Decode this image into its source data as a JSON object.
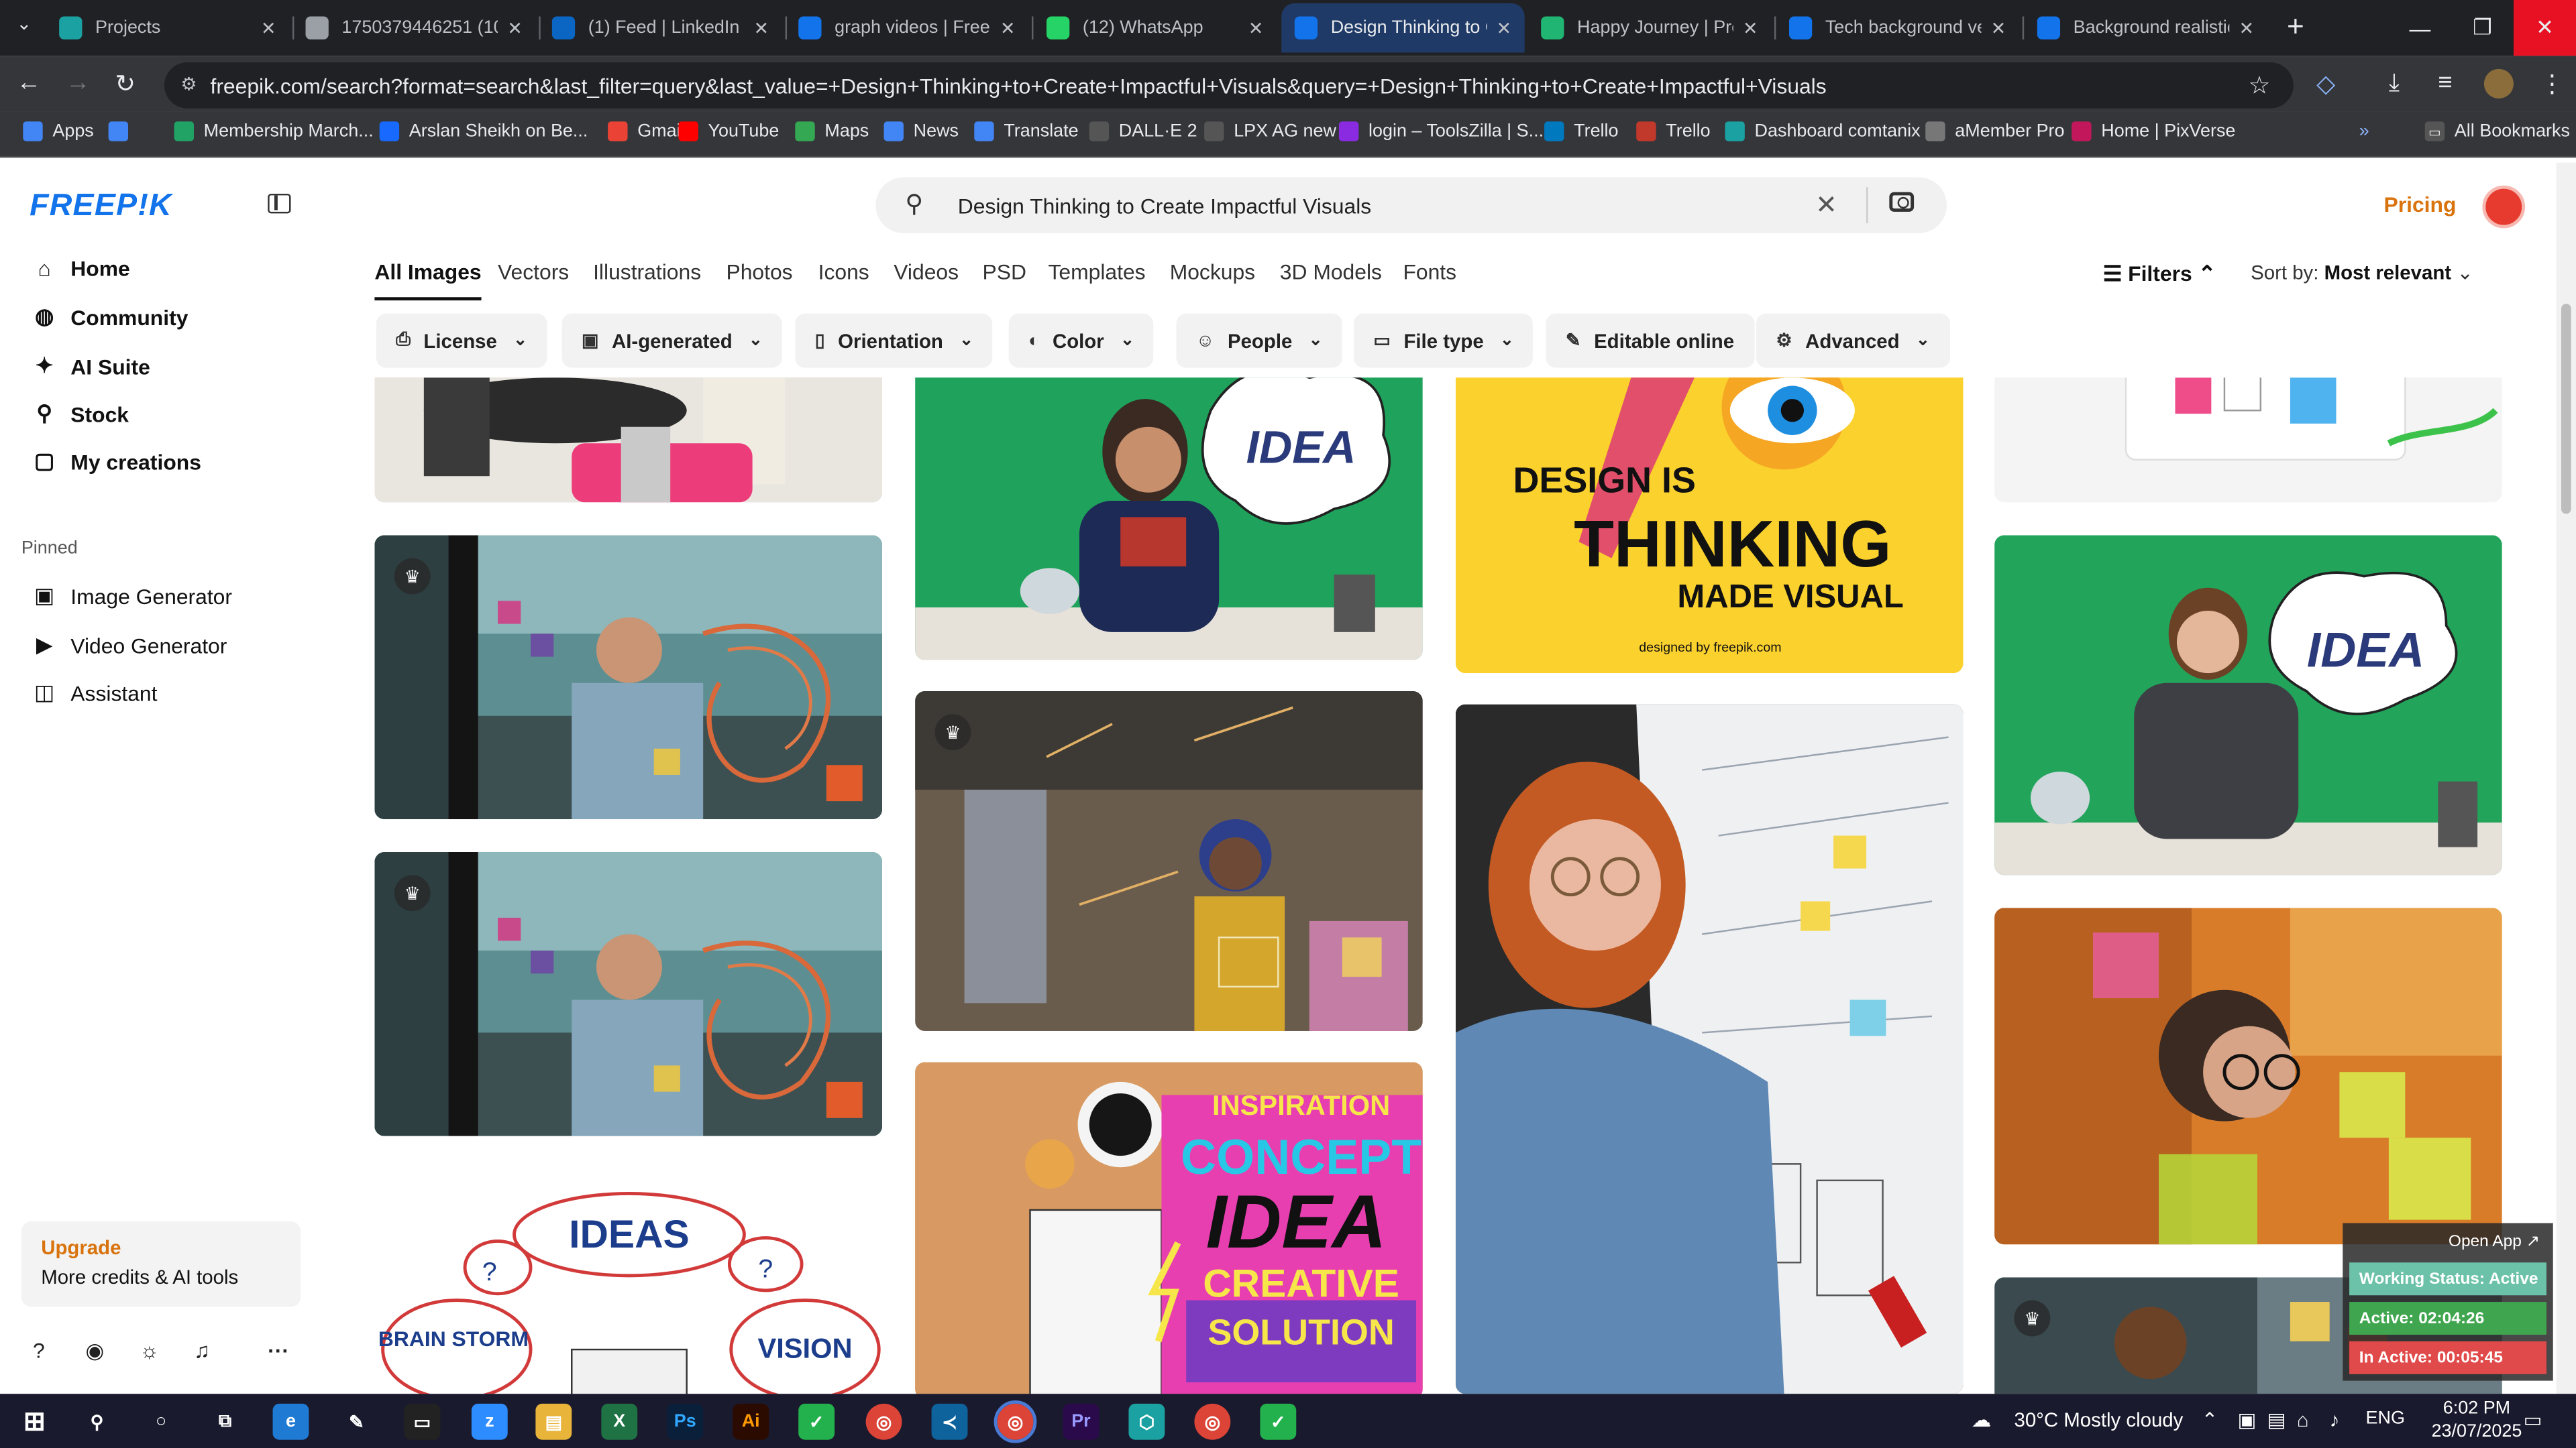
{
  "browser": {
    "tabs": [
      {
        "title": "Projects",
        "icon": "hexagon-icon",
        "color": "#1ba1a1"
      },
      {
        "title": "1750379446251 (108",
        "icon": "globe-icon",
        "color": "#9aa0a6"
      },
      {
        "title": "(1) Feed | LinkedIn",
        "icon": "linkedin-icon",
        "color": "#0a66c2"
      },
      {
        "title": "graph videos | Freepi",
        "icon": "freepik-icon",
        "color": "#1273eb"
      },
      {
        "title": "(12) WhatsApp",
        "icon": "whatsapp-icon",
        "color": "#25d366"
      },
      {
        "title": "Design Thinking to C",
        "icon": "freepik-icon",
        "color": "#1273eb"
      },
      {
        "title": "Happy Journey | Pren",
        "icon": "pen-icon",
        "color": "#21b573"
      },
      {
        "title": "Tech background ve",
        "icon": "freepik-icon",
        "color": "#1273eb"
      },
      {
        "title": "Background realistic",
        "icon": "freepik-icon",
        "color": "#1273eb"
      }
    ],
    "url": "freepik.com/search?format=search&last_filter=query&last_value=+Design+Thinking+to+Create+Impactful+Visuals&query=+Design+Thinking+to+Create+Impactful+Visuals",
    "bookmarks": [
      {
        "label": "Apps",
        "color": "#4285f4"
      },
      {
        "label": "",
        "color": "#4285f4"
      },
      {
        "label": "Membership March...",
        "color": "#21a366"
      },
      {
        "label": "Arslan Sheikh on Be...",
        "color": "#1769ff"
      },
      {
        "label": "Gmail",
        "color": "#ea4335"
      },
      {
        "label": "YouTube",
        "color": "#ff0000"
      },
      {
        "label": "Maps",
        "color": "#34a853"
      },
      {
        "label": "News",
        "color": "#4285f4"
      },
      {
        "label": "Translate",
        "color": "#4285f4"
      },
      {
        "label": "DALL·E 2",
        "color": "#555555"
      },
      {
        "label": "LPX AG new",
        "color": "#555555"
      },
      {
        "label": "login – ToolsZilla | S...",
        "color": "#8a2be2"
      },
      {
        "label": "Trello",
        "color": "#0079bf"
      },
      {
        "label": "Trello",
        "color": "#c0392b"
      },
      {
        "label": "Dashboard comtanix",
        "color": "#1ba1a1"
      },
      {
        "label": "aMember Pro",
        "color": "#777777"
      },
      {
        "label": "Home | PixVerse",
        "color": "#c2185b"
      }
    ],
    "all_bookmarks": "All Bookmarks"
  },
  "sidebar": {
    "logo": "FREEP!K",
    "nav": [
      {
        "label": "Home",
        "icon": "home-icon"
      },
      {
        "label": "Community",
        "icon": "globe-icon"
      },
      {
        "label": "AI Suite",
        "icon": "sparkle-icon"
      },
      {
        "label": "Stock",
        "icon": "search-icon"
      },
      {
        "label": "My creations",
        "icon": "folder-icon"
      }
    ],
    "pinned_label": "Pinned",
    "pinned": [
      {
        "label": "Image Generator",
        "icon": "image-icon"
      },
      {
        "label": "Video Generator",
        "icon": "video-icon"
      },
      {
        "label": "Assistant",
        "icon": "chat-icon"
      }
    ],
    "upgrade_title": "Upgrade",
    "upgrade_sub": "More credits & AI tools"
  },
  "search": {
    "value": "Design Thinking to Create Impactful Visuals"
  },
  "header": {
    "pricing": "Pricing"
  },
  "type_tabs": [
    "All Images",
    "Vectors",
    "Illustrations",
    "Photos",
    "Icons",
    "Videos",
    "PSD",
    "Templates",
    "Mockups",
    "3D Models",
    "Fonts"
  ],
  "filters_label": "Filters",
  "sort_label": "Sort by:",
  "sort_value": "Most relevant",
  "chips": [
    {
      "label": "License",
      "icon": "license-icon"
    },
    {
      "label": "AI-generated",
      "icon": "ai-icon"
    },
    {
      "label": "Orientation",
      "icon": "orientation-icon"
    },
    {
      "label": "Color",
      "icon": "palette-icon"
    },
    {
      "label": "People",
      "icon": "people-icon"
    },
    {
      "label": "File type",
      "icon": "file-icon"
    },
    {
      "label": "Editable online",
      "icon": "pencil-icon"
    },
    {
      "label": "Advanced",
      "icon": "gear-icon"
    }
  ],
  "images": {
    "design_is": "DESIGN IS",
    "thinking": "THINKING",
    "made_visual": "MADE VISUAL",
    "designed_by": "designed by freepik.com",
    "idea": "IDEA",
    "ideas": "IDEAS",
    "brain_storm": "BRAIN STORM",
    "vision": "VISION",
    "poster_lines": [
      "INSPIRATION",
      "CONCEPT",
      "IDEA",
      "CREATIVE",
      "SOLUTION"
    ]
  },
  "overlay": {
    "open_app": "Open App ↗",
    "status": "Working Status: Active",
    "active": "Active: 02:04:26",
    "inactive": "In Active: 00:05:45"
  },
  "taskbar": {
    "weather": "30°C  Mostly cloudy",
    "lang": "ENG",
    "time": "6:02 PM",
    "date": "23/07/2025"
  }
}
